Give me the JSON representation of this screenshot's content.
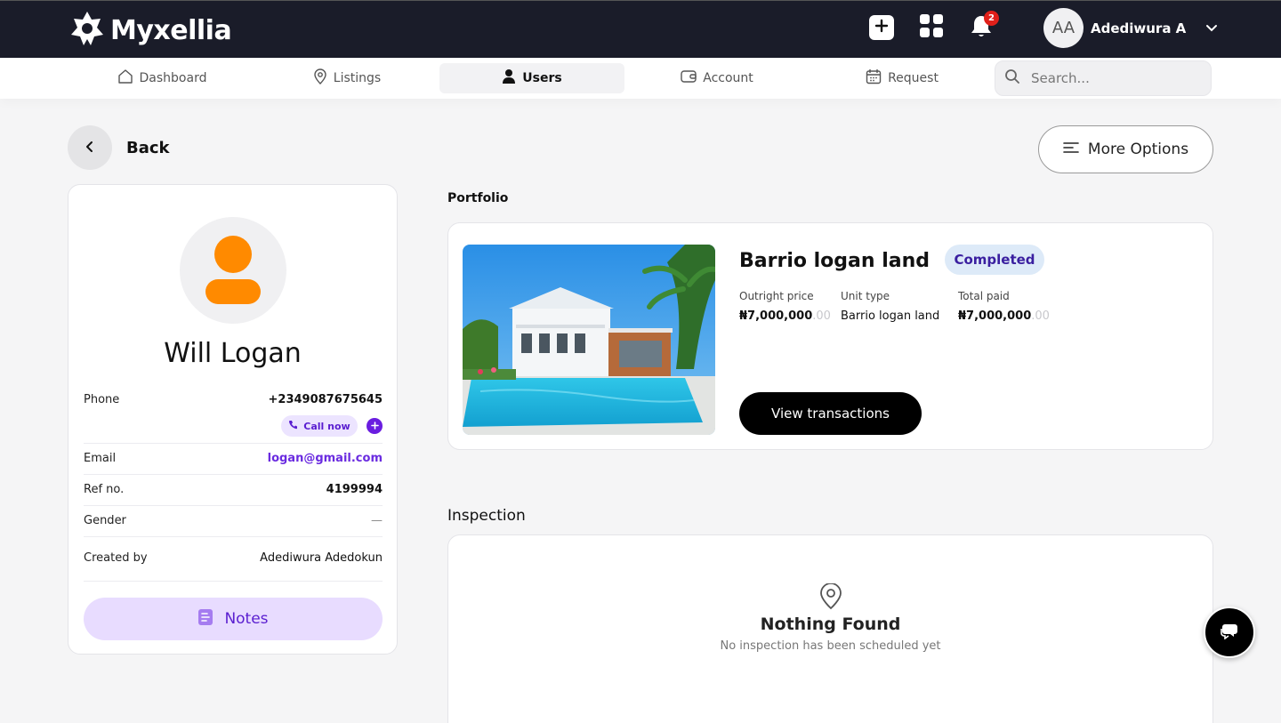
{
  "app": {
    "name": "Myxellia"
  },
  "header": {
    "notifications_count": "2",
    "user": {
      "initials": "AA",
      "name": "Adediwura A"
    }
  },
  "nav": {
    "items": [
      {
        "label": "Dashboard",
        "icon": "home-icon"
      },
      {
        "label": "Listings",
        "icon": "location-pin-icon"
      },
      {
        "label": "Users",
        "icon": "user-icon",
        "active": true
      },
      {
        "label": "Account",
        "icon": "wallet-icon"
      },
      {
        "label": "Request",
        "icon": "calendar-icon"
      }
    ],
    "search_placeholder": "Search..."
  },
  "page": {
    "back_label": "Back",
    "more_options_label": "More Options"
  },
  "profile": {
    "name": "Will Logan",
    "phone_label": "Phone",
    "phone": "+2349087675645",
    "call_now_label": "Call now",
    "email_label": "Email",
    "email": "logan@gmail.com",
    "ref_label": "Ref no.",
    "ref": "4199994",
    "gender_label": "Gender",
    "gender": "—",
    "created_by_label": "Created by",
    "created_by": "Adediwura Adedokun",
    "notes_label": "Notes"
  },
  "portfolio": {
    "section_title": "Portfolio",
    "property": {
      "title": "Barrio logan land",
      "status": "Completed",
      "outright_price_label": "Outright price",
      "outright_price": "₦7,000,000",
      "outright_price_cents": ".00",
      "unit_type_label": "Unit type",
      "unit_type": "Barrio logan land",
      "total_paid_label": "Total paid",
      "total_paid": "₦7,000,000",
      "total_paid_cents": ".00",
      "view_transactions_label": "View transactions"
    }
  },
  "inspection": {
    "section_title": "Inspection",
    "empty_title": "Nothing Found",
    "empty_subtitle": "No inspection has been scheduled yet"
  },
  "colors": {
    "topbar": "#1a1c29",
    "accent_purple": "#6a1de0",
    "profile_orange": "#ff8a00",
    "status_bg": "#ddeaf8"
  }
}
